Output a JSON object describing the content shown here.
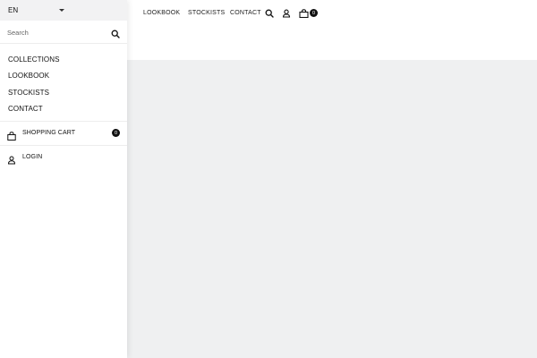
{
  "header": {
    "nav": [
      "LOOKBOOK",
      "STOCKISTS",
      "CONTACT"
    ],
    "cart_count": "0"
  },
  "menu": {
    "language": "EN",
    "search": {
      "placeholder": "Search",
      "value": ""
    },
    "items": [
      "COLLECTIONS",
      "LOOKBOOK",
      "STOCKISTS",
      "CONTACT"
    ],
    "cart_label": "SHOPPING CART",
    "cart_count": "0",
    "login_label": "LOGIN"
  },
  "icons": {
    "search": "search-icon",
    "account": "user-icon",
    "cart": "shopping-bag-icon",
    "language_toggle": "caret-down-icon"
  },
  "colors": {
    "panel_bg": "#ffffff",
    "lang_bar_bg": "#f2f2f3",
    "content_bg": "#eff0f1",
    "badge_bg": "#111111"
  }
}
